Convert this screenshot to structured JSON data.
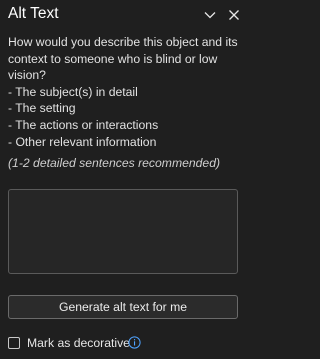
{
  "pane": {
    "title": "Alt Text",
    "collapse_icon": "chevron-down-icon",
    "close_icon": "close-icon"
  },
  "description": {
    "lines": [
      "How would you describe this object and its",
      "context to someone who is blind or low",
      "vision?",
      "- The subject(s) in detail",
      "- The setting",
      "- The actions or interactions",
      "- Other relevant information"
    ],
    "hint": "(1-2 detailed sentences recommended)"
  },
  "alt_text_input": {
    "value": ""
  },
  "generate_button": {
    "label": "Generate alt text for me"
  },
  "decorative": {
    "label": "Mark as decorative",
    "checked": false,
    "info_icon": "info-icon"
  },
  "colors": {
    "background": "#1f1f1f",
    "text": "#e6e6e6",
    "accent": "#4fa3ff"
  }
}
